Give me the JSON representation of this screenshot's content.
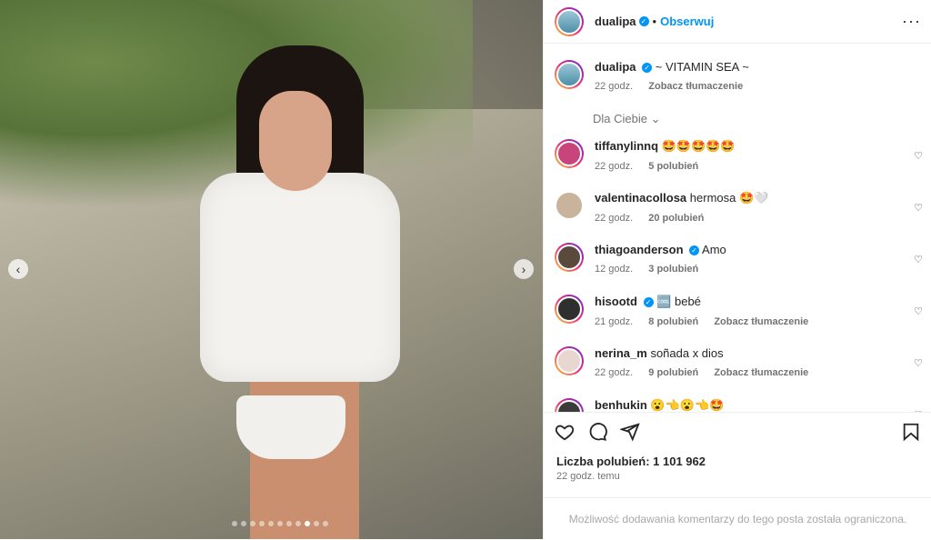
{
  "post": {
    "username": "dualipa",
    "follow_label": "Obserwuj",
    "caption": "~ VITAMIN SEA ~",
    "caption_time": "22 godz.",
    "translate_label": "Zobacz tłumaczenie",
    "filter_label": "Dla Ciebie",
    "likes_label": "Liczba polubień: 1 101 962",
    "time_ago": "22 godz. temu",
    "comments_disabled": "Możliwość dodawania komentarzy do tego posta została ograniczona."
  },
  "carousel": {
    "total": 11,
    "active_index": 8
  },
  "comments": [
    {
      "user": "tiffanylinnq",
      "text": "🤩🤩🤩🤩🤩",
      "time": "22 godz.",
      "likes": "5 polubień",
      "translate": "",
      "verified": false
    },
    {
      "user": "valentinacollosa",
      "text": "hermosa 🤩🤍",
      "time": "22 godz.",
      "likes": "20 polubień",
      "translate": "",
      "verified": false
    },
    {
      "user": "thiagoanderson",
      "text": "Amo",
      "time": "12 godz.",
      "likes": "3 polubień",
      "translate": "",
      "verified": true
    },
    {
      "user": "hisootd",
      "text": "🆒 bebé",
      "time": "21 godz.",
      "likes": "8 polubień",
      "translate": "Zobacz tłumaczenie",
      "verified": true
    },
    {
      "user": "nerina_m",
      "text": "soñada x dios",
      "time": "22 godz.",
      "likes": "9 polubień",
      "translate": "Zobacz tłumaczenie",
      "verified": false
    },
    {
      "user": "benhukin",
      "text": "😮👈😮👈🤩",
      "time": "",
      "likes": "",
      "translate": "",
      "verified": false
    }
  ],
  "colors": {
    "accent": "#0095f6",
    "muted": "#737373"
  }
}
